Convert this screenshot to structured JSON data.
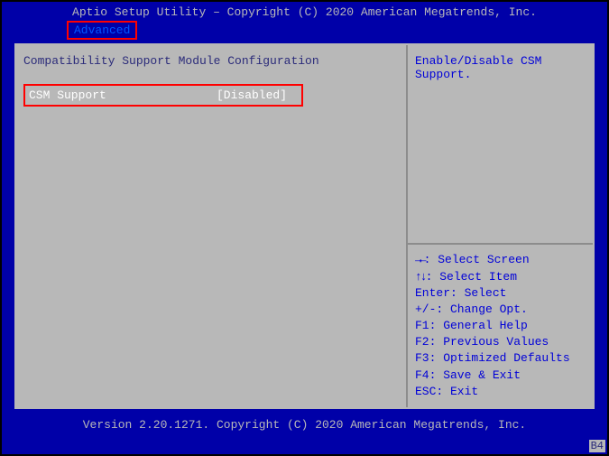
{
  "header": {
    "title": "Aptio Setup Utility – Copyright (C) 2020 American Megatrends, Inc.",
    "tab": "Advanced"
  },
  "main": {
    "section_title": "Compatibility Support Module Configuration",
    "option": {
      "label": "CSM Support",
      "value": "[Disabled]"
    }
  },
  "help": {
    "description": "Enable/Disable CSM Support."
  },
  "keys": {
    "select_screen": ": Select Screen",
    "select_item": ": Select Item",
    "enter": "Enter: Select",
    "plusminus": "+/-: Change Opt.",
    "f1": "F1: General Help",
    "f2": "F2: Previous Values",
    "f3": "F3: Optimized Defaults",
    "f4": "F4: Save & Exit",
    "esc": "ESC: Exit"
  },
  "footer": {
    "version": "Version 2.20.1271. Copyright (C) 2020 American Megatrends, Inc."
  },
  "badge": "B4"
}
